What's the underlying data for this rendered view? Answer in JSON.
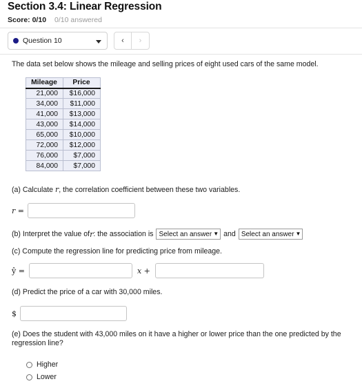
{
  "header": {
    "title": "Section 3.4: Linear Regression",
    "score_label": "Score: 0/10",
    "answered_label": "0/10 answered"
  },
  "nav": {
    "question_label": "Question 10",
    "prev_label": "‹",
    "next_label": "›",
    "dot_color": "#1b1b86"
  },
  "question": {
    "prompt": "The data set below shows the mileage and selling prices of eight used cars of the same model."
  },
  "table": {
    "columns": [
      "Mileage",
      "Price"
    ],
    "rows": [
      [
        "21,000",
        "$16,000"
      ],
      [
        "34,000",
        "$11,000"
      ],
      [
        "41,000",
        "$13,000"
      ],
      [
        "43,000",
        "$14,000"
      ],
      [
        "65,000",
        "$10,000"
      ],
      [
        "72,000",
        "$12,000"
      ],
      [
        "76,000",
        "$7,000"
      ],
      [
        "84,000",
        "$7,000"
      ]
    ]
  },
  "parts": {
    "a": {
      "text": "(a) Calculate r, the correlation coefficient between these two variables.",
      "text_pre": "(a) Calculate ",
      "var": "r",
      "text_post": ", the correlation coefficient between these two variables.",
      "input_label_var": "r",
      "input_label_eq": " =",
      "input_value": "",
      "input_placeholder": ""
    },
    "b": {
      "text_pre": "(b) Interpret the value of ",
      "var": "r",
      "text_mid": ": the association is",
      "select1_value": "Select an answer",
      "select2_value": "Select an answer",
      "conjunction": "and",
      "chevron": "⌄"
    },
    "c": {
      "text": "(c) Compute the regression line for predicting price from mileage.",
      "yhat": "ŷ =",
      "slope_value": "",
      "x_plus": "x +",
      "intercept_value": ""
    },
    "d": {
      "text": "(d) Predict the price of a car with 30,000 miles.",
      "dollar": "$",
      "input_value": ""
    },
    "e": {
      "text": "(e) Does the student with 43,000 miles on it have a higher or lower price than the one predicted by the regression line?",
      "options": [
        "Higher",
        "Lower"
      ]
    }
  }
}
